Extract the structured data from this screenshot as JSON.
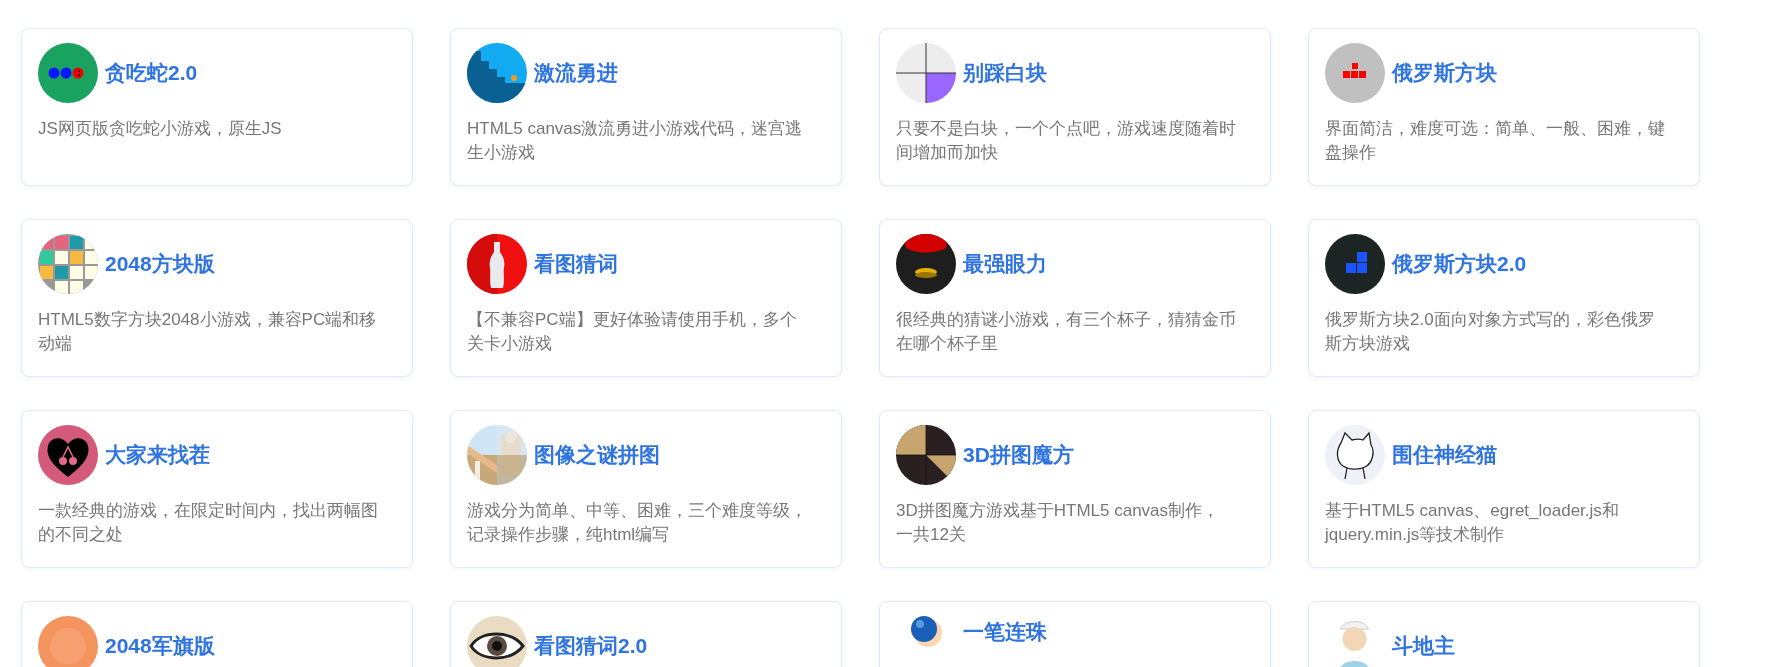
{
  "games": [
    {
      "title": "贪吃蛇2.0",
      "description": "JS网页版贪吃蛇小游戏，原生JS"
    },
    {
      "title": "激流勇进",
      "description": "HTML5 canvas激流勇进小游戏代码，迷宫逃生小游戏"
    },
    {
      "title": "别踩白块",
      "description": "只要不是白块，一个个点吧，游戏速度随着时间增加而加快"
    },
    {
      "title": "俄罗斯方块",
      "description": "界面简洁，难度可选：简单、一般、困难，键盘操作"
    },
    {
      "title": "2048方块版",
      "description": "HTML5数字方块2048小游戏，兼容PC端和移动端"
    },
    {
      "title": "看图猜词",
      "description": "【不兼容PC端】更好体验请使用手机，多个关卡小游戏"
    },
    {
      "title": "最强眼力",
      "description": "很经典的猜谜小游戏，有三个杯子，猜猜金币在哪个杯子里"
    },
    {
      "title": "俄罗斯方块2.0",
      "description": "俄罗斯方块2.0面向对象方式写的，彩色俄罗斯方块游戏"
    },
    {
      "title": "大家来找茬",
      "description": "一款经典的游戏，在限定时间内，找出两幅图的不同之处"
    },
    {
      "title": "图像之谜拼图",
      "description": "游戏分为简单、中等、困难，三个难度等级，记录操作步骤，纯html编写"
    },
    {
      "title": "3D拼图魔方",
      "description": "3D拼图魔方游戏基于HTML5 canvas制作，一共12关"
    },
    {
      "title": "围住神经猫",
      "description": "基于HTML5 canvas、egret_loader.js和jquery.min.js等技术制作"
    },
    {
      "title": "2048军旗版"
    },
    {
      "title": "看图猜词2.0"
    },
    {
      "title": "一笔连珠"
    },
    {
      "title": "斗地主"
    }
  ]
}
